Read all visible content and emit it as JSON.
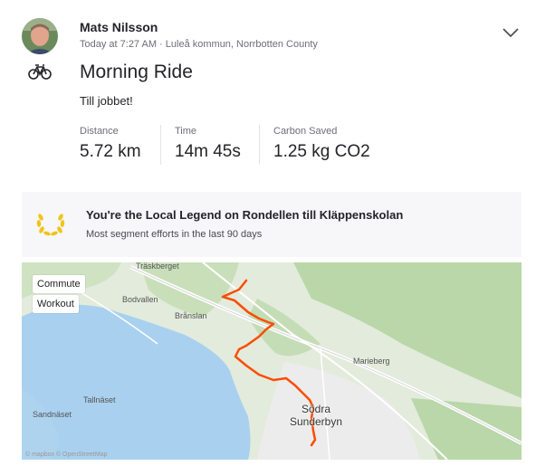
{
  "athlete": {
    "name": "Mats Nilsson"
  },
  "activity": {
    "meta": "Today at 7:27 AM · Luleå kommun, Norrbotten County",
    "title": "Morning Ride",
    "description": "Till jobbet!",
    "sport_icon": "bike-icon"
  },
  "stats": [
    {
      "label": "Distance",
      "value": "5.72 km"
    },
    {
      "label": "Time",
      "value": "14m 45s"
    },
    {
      "label": "Carbon Saved",
      "value": "1.25 kg CO2"
    }
  ],
  "local_legend": {
    "icon": "laurel-icon",
    "title": "You're the Local Legend on Rondellen till Kläppenskolan",
    "subtitle": "Most segment efforts in the last 90 days",
    "color": "#f0c419"
  },
  "map": {
    "tags": [
      "Commute",
      "Workout"
    ],
    "places": {
      "traskberget": "Träskberget",
      "bodvallen": "Bodvallen",
      "branslan": "Brånslan",
      "marieberg": "Marieberg",
      "tallnaset": "Tallnäset",
      "sandnaset": "Sandnäset",
      "sodra_1": "Södra",
      "sodra_2": "Sunderbyn"
    },
    "route_color": "#fc4c02",
    "water_color": "#a9d1ef",
    "attribution": "© mapbox © OpenStreetMap"
  }
}
